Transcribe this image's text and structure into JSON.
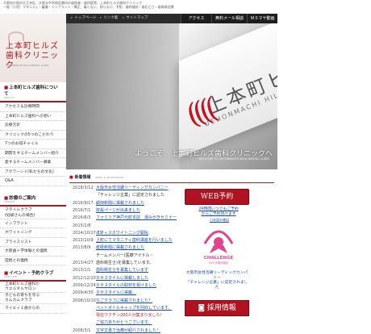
{
  "header": {
    "intro_line1": "大阪府大阪市天王寺区、大阪＆中学校区圏内の歯医者・歯科医院、上本町ヒルズ歯科クリニック",
    "intro_line2": "一般（小児）マタニティ・審美・インプラント・矯正、痛くない、削らない、予防、歯科検診・歯石とり・歯周病治療"
  },
  "logo": {
    "name_line1": "上本町ヒルズ",
    "name_line2": "歯科クリニック",
    "name_en": "UEHONMACHI HILLS DENTAL CLINIC",
    "accent_color": "#b1121f"
  },
  "nav": {
    "items": [
      "トップページ",
      "リンク集",
      "サイトマップ"
    ],
    "access": "アクセス",
    "mail": "無料メール相談",
    "mobile": "ＭＳマヤ動画"
  },
  "hero": {
    "sign_jp": "上本町ヒルズ",
    "sign_en": "UEHONMACHI HILLS",
    "caption": "ようこそ、上本町ヒルズ歯科クリニックへ",
    "caption_en": "WELCOME TO UEHONMACHI HILLS DENTAL CLINIC"
  },
  "sidebar": {
    "about_title": "上本町ヒルズ歯科について",
    "about_sub": "ABOUT US",
    "about_items": [
      "アクセス＆診療時間",
      "上本町ヒルズ歯科への想い",
      "診療方針",
      "クリニックの5つのこだわり",
      "7つのお得チャイル",
      "期間をするチームメンバー紹介",
      "愛するチームメンバー募集",
      "アクワーンド(私たちの文化)",
      "Q&A"
    ],
    "guide_title": "診療のご案内",
    "guide_sub": "GUIDANCE",
    "guide_items": [
      "マタイルクラブ\n(妊婦さんの場合)",
      "インプラント",
      "ホワイトニング",
      "プライスリスト",
      "大阪歯＋学体験との連携",
      "提携との連携"
    ],
    "event_title": "イベント・予約クラブ",
    "event_sub": "EVENT CLUB",
    "event_items": [
      "上本町ヒルズ歯科ｶﾝ\nウエルネルサロン",
      "子どもの育ちを守る\nカムカムクラブ",
      "マイエイ１歳からの"
    ]
  },
  "news": {
    "title": "新着情報",
    "subtitle": "NEWS ＆ INFORMATION",
    "rows": [
      {
        "date": "2018/3/12",
        "text": "大阪市女性活躍リーディングカンパニー",
        "style": "link"
      },
      {
        "date": "",
        "text": "「チャレンジ企業」に認定されました",
        "style": "plain"
      },
      {
        "date": "2016/9/17",
        "text": "顧田新聞に掲載されました",
        "style": "link"
      },
      {
        "date": "2016/7/1",
        "text": "院長ページが出来ました",
        "style": "link"
      },
      {
        "date": "2016/6/3",
        "text": "ファミリア神戸元町本店　運みがきセミナー",
        "style": "link"
      },
      {
        "date": "2015/1/8",
        "text": "",
        "style": "plain"
      },
      {
        "date": "2014/10/17-19",
        "text": "オフィスホワイトニング開始",
        "style": "link"
      },
      {
        "date": "2013/10/9",
        "text": "上町にてマタニティ歯科講座を行いました",
        "style": "link"
      },
      {
        "date": "2013/8/9",
        "text": "産経新聞に掲載されました",
        "style": "link"
      },
      {
        "date": "",
        "text": "チームメンバー(医療アイドル・",
        "style": "plain"
      },
      {
        "date": "2013/4/27",
        "text": "歯科衛生士)を募集しています。",
        "style": "plain"
      },
      {
        "date": "2013/1/1",
        "text": "歯科衛生士を募集しています",
        "style": "link"
      },
      {
        "date": "2012/12/10",
        "text": "ＤＨスタイルに掲載しました",
        "style": "link"
      },
      {
        "date": "2009/12/24",
        "text": "ＤＨスタイルの取材を受けました",
        "style": "link"
      },
      {
        "date": "2009/4/30",
        "text": "ＤＨスタイルに掲載、",
        "style": "link"
      },
      {
        "date": "2008/10/10",
        "text": "なごクラブに掲載されました！",
        "style": "link"
      },
      {
        "date": "",
        "text": "ペットボトルキャップを回収しています。",
        "style": "link"
      },
      {
        "date": "",
        "text": "現在ワクチン200人分集まりました！",
        "style": "red"
      },
      {
        "date": "",
        "text": "ご協力ありがとうございます。",
        "style": "link"
      },
      {
        "date": "2008/3/1",
        "text": "文字文書で治療が紹介されました！",
        "style": "link"
      }
    ]
  },
  "right": {
    "web_reserve": "WEB予約",
    "web_note": "24時間いつでもご予約からご予約頂けます",
    "lang_link": "日本語の確認",
    "challenge_badge": "CHALLENGE",
    "challenge_year": "2017大阪市認定",
    "challenge_text_line1": "大阪市女性活躍リーディングカンパニー",
    "challenge_text_line2": "「チャレンジ企業」に認定されました",
    "recruit": "採用情報"
  }
}
